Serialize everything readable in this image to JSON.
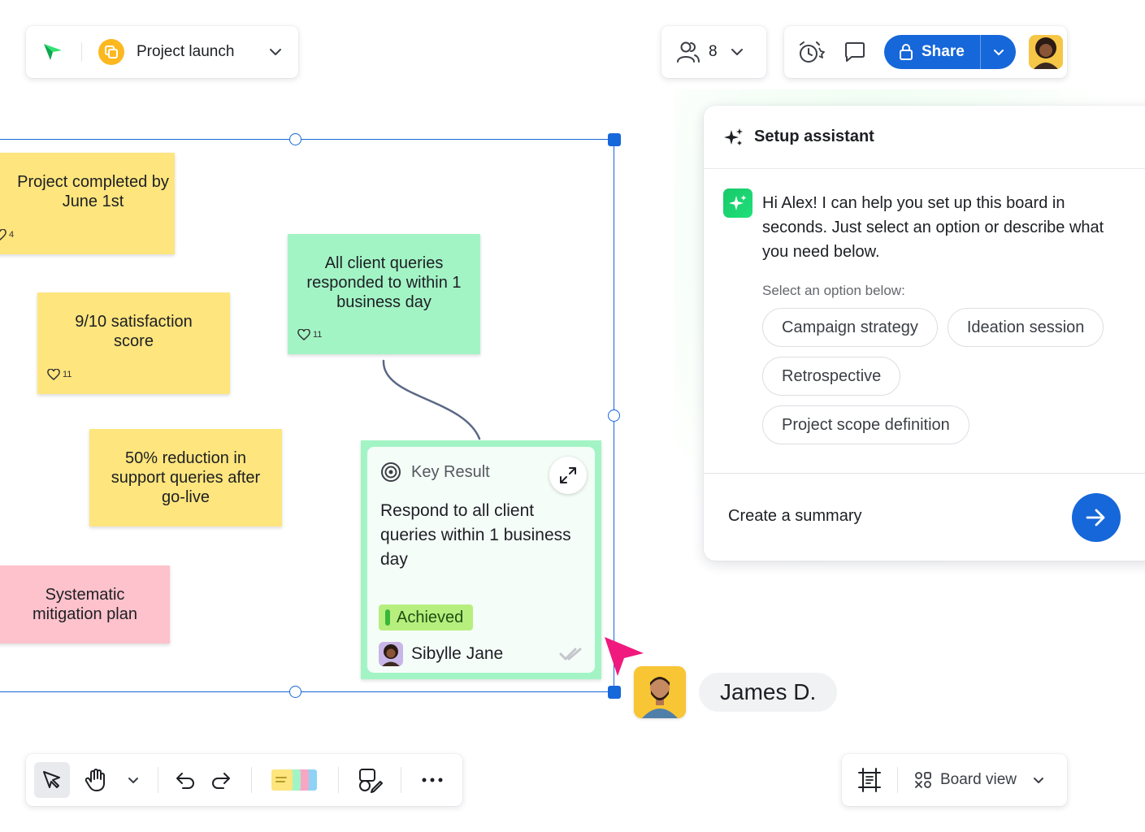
{
  "board": {
    "name": "Project launch"
  },
  "collaborators": {
    "count": "8"
  },
  "toolbar": {
    "share_label": "Share"
  },
  "stickies": {
    "s1": {
      "text": "Project completed by June 1st",
      "likes": "4"
    },
    "s2": {
      "text": "9/10 satisfaction score",
      "likes": "11"
    },
    "s3": {
      "text": "All client queries responded to within 1 business day",
      "likes": "11"
    },
    "s4": {
      "text": "50% reduction in support queries after go-live"
    },
    "s5": {
      "text": "Systematic mitigation plan"
    }
  },
  "key_result": {
    "header": "Key Result",
    "text": "Respond to all client queries within 1 business day",
    "status": "Achieved",
    "owner": "Sibylle Jane"
  },
  "cursor_user": {
    "name": "James D."
  },
  "assistant": {
    "title": "Setup assistant",
    "message": "Hi Alex! I can help you set up this board in seconds. Just select an option or describe what you need below.",
    "options_label": "Select an option below:",
    "options": [
      "Campaign strategy",
      "Ideation session",
      "Retrospective",
      "Project scope definition"
    ],
    "summary_prompt": "Create a summary"
  },
  "view": {
    "label": "Board view"
  },
  "colors": {
    "accent": "#1667d9",
    "sticky_yellow": "#fee57d",
    "sticky_green": "#a3f4c5",
    "sticky_pink": "#fdc2cb",
    "status_achieved": "#b7ef7e",
    "cursor": "#f0197d"
  }
}
